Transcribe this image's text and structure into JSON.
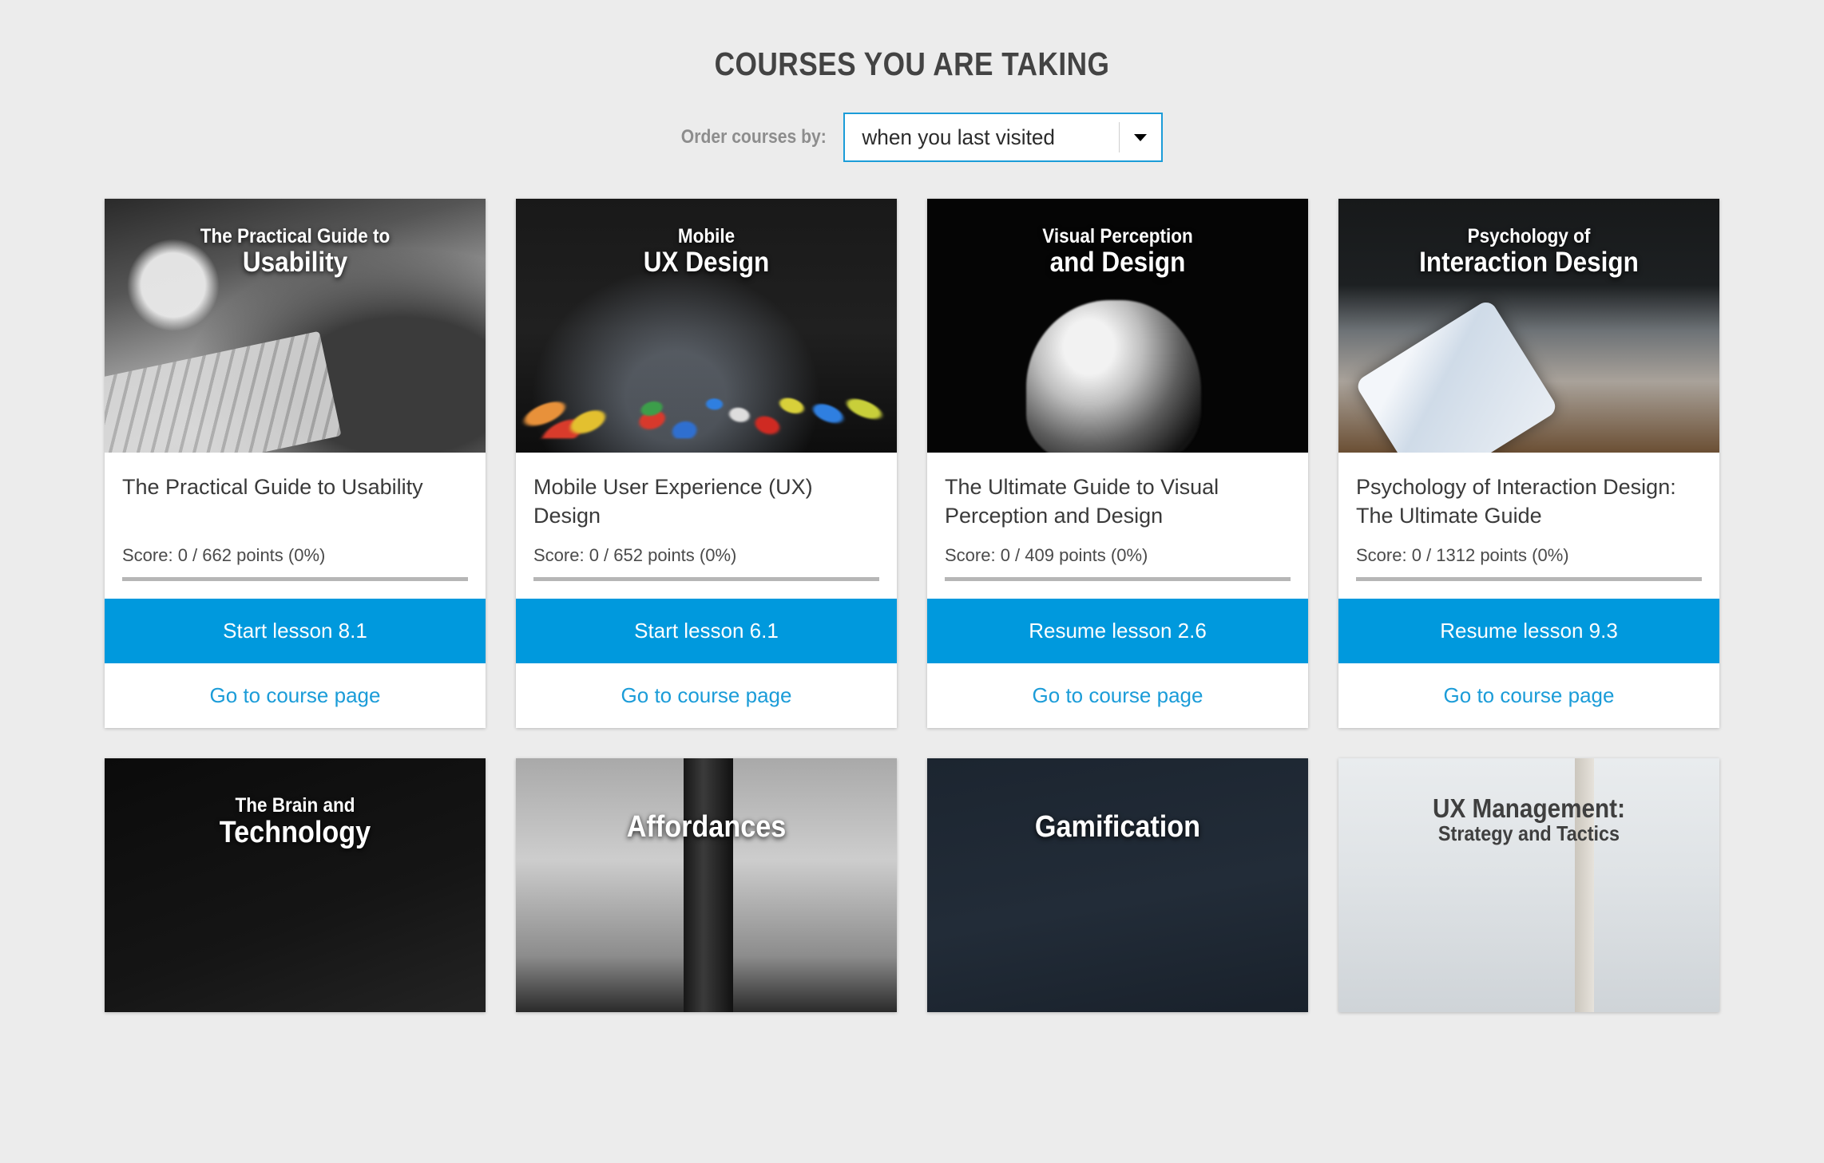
{
  "header": {
    "title": "COURSES YOU ARE TAKING"
  },
  "order_bar": {
    "label": "Order courses by:",
    "selected": "when you last visited",
    "caret_icon": "chevron-down-icon",
    "accent_color": "#1b9cd8"
  },
  "theme": {
    "background": "#ececec",
    "accent": "#0099dd",
    "link": "#1b9cd8",
    "title_color": "#434343"
  },
  "courses": [
    {
      "thumb_line1": "The Practical Guide to",
      "thumb_line2": "Usability",
      "thumb_style": "art-usability",
      "title": "The Practical Guide to Usability",
      "score": "Score: 0 / 662 points (0%)",
      "score_points": 0,
      "score_total": 662,
      "score_percent": 0,
      "primary_action": "Start lesson 8.1",
      "secondary_action": "Go to course page"
    },
    {
      "thumb_line1": "Mobile",
      "thumb_line2": "UX Design",
      "thumb_style": "art-mobile",
      "title": "Mobile User Experience (UX) Design",
      "score": "Score: 0 / 652 points (0%)",
      "score_points": 0,
      "score_total": 652,
      "score_percent": 0,
      "primary_action": "Start lesson 6.1",
      "secondary_action": "Go to course page"
    },
    {
      "thumb_line1": "Visual Perception",
      "thumb_line2": "and Design",
      "thumb_style": "art-visual",
      "title": "The Ultimate Guide to Visual Perception and Design",
      "score": "Score: 0 / 409 points (0%)",
      "score_points": 0,
      "score_total": 409,
      "score_percent": 0,
      "primary_action": "Resume lesson 2.6",
      "secondary_action": "Go to course page"
    },
    {
      "thumb_line1": "Psychology of",
      "thumb_line2": "Interaction Design",
      "thumb_style": "art-psych",
      "title": "Psychology of Interaction Design: The Ultimate Guide",
      "score": "Score: 0 / 1312 points (0%)",
      "score_points": 0,
      "score_total": 1312,
      "score_percent": 0,
      "primary_action": "Resume lesson 9.3",
      "secondary_action": "Go to course page"
    }
  ],
  "courses_row2": [
    {
      "thumb_line1": "The Brain and",
      "thumb_line2": "Technology",
      "thumb_style": "art-brain",
      "dark_text": false
    },
    {
      "thumb_line1": "",
      "thumb_line2": "Affordances",
      "thumb_style": "art-afford",
      "dark_text": false
    },
    {
      "thumb_line1": "",
      "thumb_line2": "Gamification",
      "thumb_style": "art-gami",
      "dark_text": false
    },
    {
      "thumb_line1": "UX Management:",
      "thumb_line2": "Strategy and Tactics",
      "thumb_style": "art-uxm",
      "dark_text": true
    }
  ]
}
